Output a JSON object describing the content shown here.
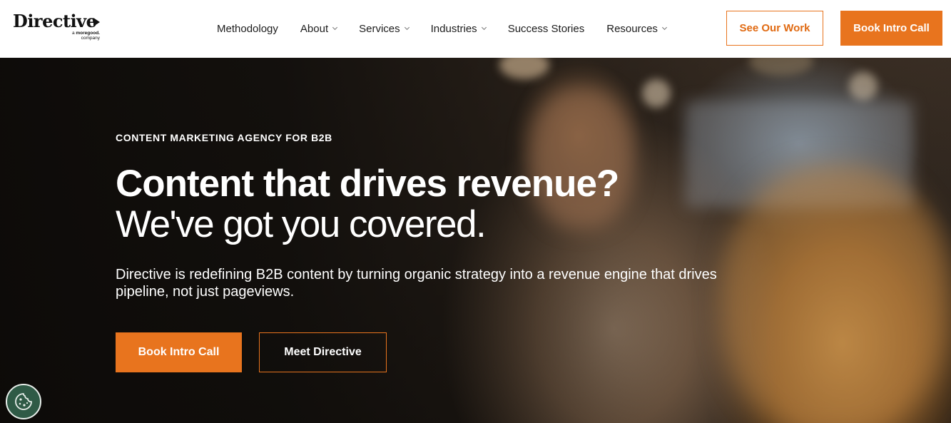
{
  "brand": {
    "name": "Directive",
    "tagline_prefix": "a",
    "tagline_brand": "moregood.",
    "tagline_suffix": "company"
  },
  "nav": {
    "items": [
      {
        "label": "Methodology",
        "has_dropdown": false
      },
      {
        "label": "About",
        "has_dropdown": true
      },
      {
        "label": "Services",
        "has_dropdown": true
      },
      {
        "label": "Industries",
        "has_dropdown": true
      },
      {
        "label": "Success Stories",
        "has_dropdown": false
      },
      {
        "label": "Resources",
        "has_dropdown": true
      }
    ],
    "see_work_label": "See Our Work",
    "book_call_label": "Book Intro Call"
  },
  "hero": {
    "eyebrow": "CONTENT MARKETING AGENCY FOR B2B",
    "title_line1": "Content that drives revenue?",
    "title_line2": "We've got you covered.",
    "description": "Directive is redefining B2B content by turning organic strategy into a revenue engine that drives pipeline, not just pageviews.",
    "primary_cta": "Book Intro Call",
    "secondary_cta": "Meet Directive"
  },
  "cookie": {
    "icon": "cookie-icon"
  },
  "colors": {
    "accent": "#e8741e",
    "cookie_bg": "#2f5a46",
    "text_dark": "#1c1c1c"
  }
}
